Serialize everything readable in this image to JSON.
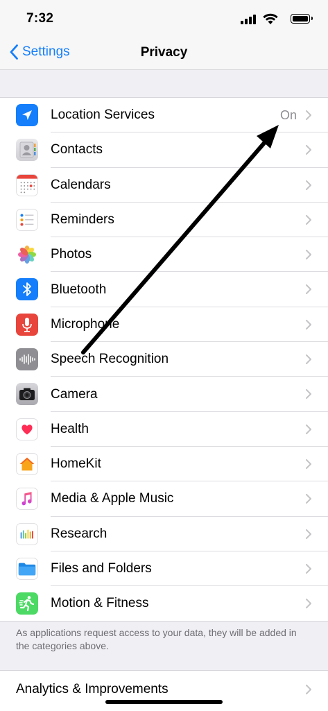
{
  "status_bar": {
    "time": "7:32"
  },
  "nav": {
    "back_label": "Settings",
    "title": "Privacy"
  },
  "rows": [
    {
      "label": "Location Services",
      "detail": "On",
      "icon": "location-arrow-icon"
    },
    {
      "label": "Contacts",
      "detail": "",
      "icon": "contacts-icon"
    },
    {
      "label": "Calendars",
      "detail": "",
      "icon": "calendar-icon"
    },
    {
      "label": "Reminders",
      "detail": "",
      "icon": "reminders-icon"
    },
    {
      "label": "Photos",
      "detail": "",
      "icon": "photos-icon"
    },
    {
      "label": "Bluetooth",
      "detail": "",
      "icon": "bluetooth-icon"
    },
    {
      "label": "Microphone",
      "detail": "",
      "icon": "microphone-icon"
    },
    {
      "label": "Speech Recognition",
      "detail": "",
      "icon": "speech-waveform-icon"
    },
    {
      "label": "Camera",
      "detail": "",
      "icon": "camera-icon"
    },
    {
      "label": "Health",
      "detail": "",
      "icon": "heart-icon"
    },
    {
      "label": "HomeKit",
      "detail": "",
      "icon": "home-icon"
    },
    {
      "label": "Media & Apple Music",
      "detail": "",
      "icon": "music-note-icon"
    },
    {
      "label": "Research",
      "detail": "",
      "icon": "research-icon"
    },
    {
      "label": "Files and Folders",
      "detail": "",
      "icon": "folder-icon"
    },
    {
      "label": "Motion & Fitness",
      "detail": "",
      "icon": "running-figure-icon"
    }
  ],
  "footer_note": "As applications request access to your data, they will be added in the categories above.",
  "section2": {
    "label": "Analytics & Improvements"
  },
  "colors": {
    "accent": "#147efb",
    "annotation_arrow": "#000000"
  }
}
